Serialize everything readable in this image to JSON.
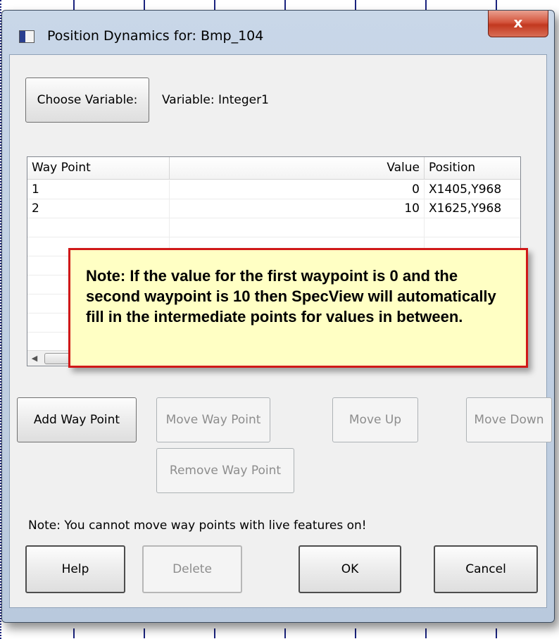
{
  "window": {
    "title": "Position Dynamics for: Bmp_104",
    "close_glyph": "x"
  },
  "variable": {
    "choose_label": "Choose Variable:",
    "text": "Variable: Integer1"
  },
  "table": {
    "headers": [
      "Way Point",
      "Value",
      "Position"
    ],
    "rows": [
      [
        "1",
        "0",
        "X1405,Y968"
      ],
      [
        "2",
        "10",
        "X1625,Y968"
      ]
    ]
  },
  "callout": {
    "text": "Note: If the value for the first waypoint is 0 and the second waypoint is 10 then SpecView will automatically fill in the intermediate points for values in between."
  },
  "buttons": {
    "add": "Add Way Point",
    "move": "Move Way Point",
    "move_up": "Move Up",
    "move_down": "Move Down",
    "remove": "Remove Way Point",
    "help": "Help",
    "delete": "Delete",
    "ok": "OK",
    "cancel": "Cancel"
  },
  "note": "Note: You cannot move way points with live features on!",
  "icons": {
    "app": "window-icon",
    "close": "close-icon",
    "scroll_left": "chevron-left-icon"
  }
}
